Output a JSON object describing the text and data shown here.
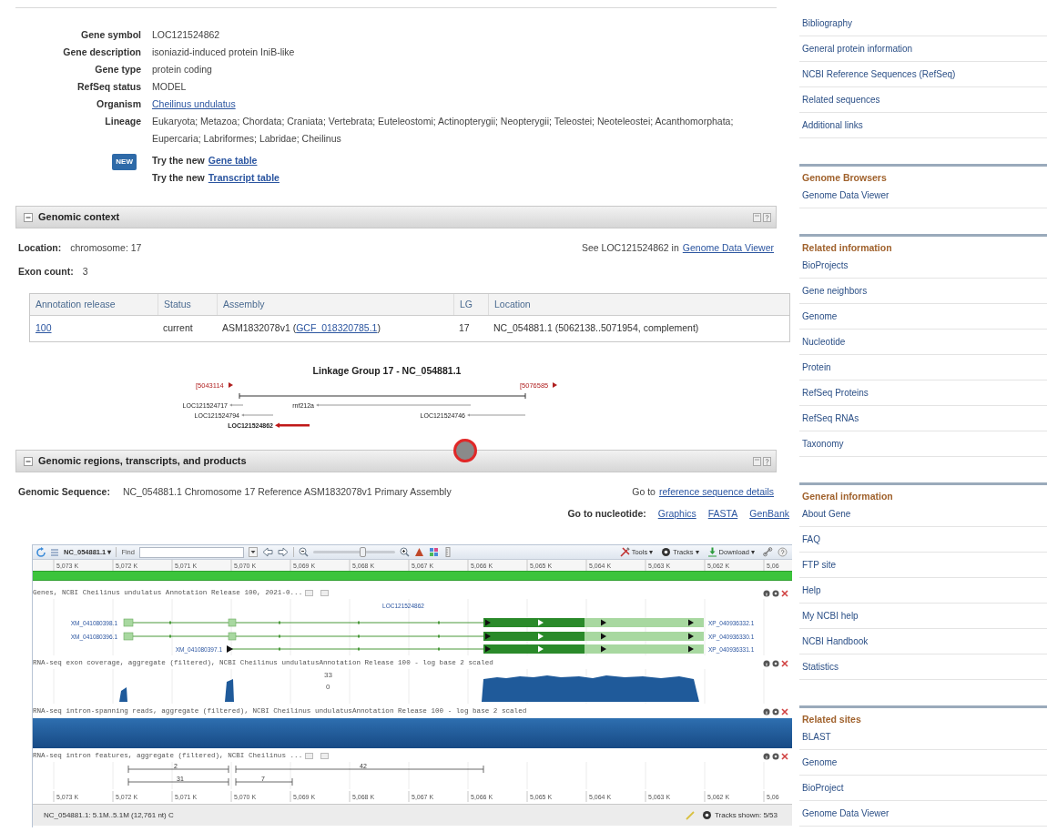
{
  "gene_summary": {
    "rows": [
      {
        "label": "Gene symbol",
        "value": "LOC121524862",
        "link": false
      },
      {
        "label": "Gene description",
        "value": "isoniazid-induced protein IniB-like",
        "link": false
      },
      {
        "label": "Gene type",
        "value": "protein coding",
        "link": false
      },
      {
        "label": "RefSeq status",
        "value": "MODEL",
        "link": false
      },
      {
        "label": "Organism",
        "value": "Cheilinus undulatus",
        "link": true
      },
      {
        "label": "Lineage",
        "value": "Eukaryota; Metazoa; Chordata; Craniata; Vertebrata; Euteleostomi; Actinopterygii; Neopterygii; Teleostei; Neoteleostei; Acanthomorphata; Eupercaria; Labriformes; Labridae; Cheilinus",
        "link": false
      }
    ],
    "badge": "NEW",
    "try_links": [
      {
        "prefix": "Try the new",
        "link": "Gene table"
      },
      {
        "prefix": "Try the new",
        "link": "Transcript table"
      }
    ]
  },
  "genomic_context": {
    "title": "Genomic context",
    "expanded": true,
    "location_label": "Location:",
    "location_value": "chromosome: 17",
    "see_text": "See LOC121524862 in",
    "see_link": "Genome Data Viewer",
    "exon_label": "Exon count:",
    "exon_value": "3",
    "table": {
      "columns": [
        "Annotation release",
        "Status",
        "Assembly",
        "LG",
        "Location"
      ],
      "rows": [
        [
          {
            "text": "100",
            "link": true
          },
          {
            "text": "current"
          },
          {
            "text": "ASM1832078v1 (",
            "link_text": "GCF_018320785.1",
            "after": ")"
          },
          {
            "text": "17"
          },
          {
            "text": "NC_054881.1 (5062138..5071954, complement)"
          }
        ]
      ]
    },
    "map": {
      "title": "Linkage Group 17 - NC_054881.1",
      "left_coord": "[5043114",
      "right_coord": "[5076585",
      "genes": [
        {
          "label": "LOC121524717",
          "current": false
        },
        {
          "label": "rnf212a",
          "current": false
        },
        {
          "label": "LOC121524794",
          "current": false
        },
        {
          "label": "LOC121524746",
          "current": false
        },
        {
          "label": "LOC121524862",
          "current": true
        }
      ]
    }
  },
  "genomic_regions": {
    "title": "Genomic regions, transcripts, and products",
    "expanded": true,
    "sequence_label": "Genomic Sequence:",
    "sequence_value": "NC_054881.1 Chromosome 17 Reference ASM1832078v1 Primary Assembly",
    "goto_text": "Go to",
    "goto_link": "reference sequence details",
    "nucleotide_label": "Go to nucleotide:",
    "nucleotide_links": [
      "Graphics",
      "FASTA",
      "GenBank"
    ],
    "viewer": {
      "sequence_menu": "NC_054881.1 ▾",
      "find_label": "Find",
      "zoom_slider": {
        "level": 0.62
      },
      "menus": [
        "Tools ▾",
        "Tracks ▾",
        "Download ▾"
      ],
      "top_ruler": [
        "5,073 K",
        "5,072 K",
        "5,071 K",
        "5,070 K",
        "5,069 K",
        "5,068 K",
        "5,067 K",
        "5,066 K",
        "5,065 K",
        "5,064 K",
        "5,063 K",
        "5,062 K",
        "5,06"
      ],
      "tracks": [
        {
          "kind": "genes",
          "title": "Genes, NCBI Cheilinus undulatus Annotation Release 100, 2021-0...",
          "gene_label": "LOC121524862",
          "transcripts": [
            {
              "left_label": "XM_041080398.1",
              "right_label": "XP_040936332.1"
            },
            {
              "left_label": "XM_041080396.1",
              "right_label": "XP_040936330.1"
            },
            {
              "left_label": "XM_041080397.1",
              "right_label": "XP_040936331.1"
            }
          ]
        },
        {
          "kind": "coverage",
          "title": "RNA-seq exon coverage, aggregate (filtered), NCBI Cheilinus undulatusAnnotation Release 100 - log base 2 scaled",
          "max_label": "33",
          "min_label": "0"
        },
        {
          "kind": "reads",
          "title": "RNA-seq intron-spanning reads, aggregate (filtered), NCBI Cheilinus undulatusAnnotation Release 100 - log base 2 scaled"
        },
        {
          "kind": "features",
          "title": "RNA-seq intron features, aggregate (filtered), NCBI Cheilinus ...",
          "features": [
            "2",
            "42",
            "31",
            "7"
          ]
        }
      ],
      "bottom_ruler": [
        "5,073 K",
        "5,072 K",
        "5,071 K",
        "5,070 K",
        "5,069 K",
        "5,068 K",
        "5,067 K",
        "5,066 K",
        "5,065 K",
        "5,064 K",
        "5,063 K",
        "5,062 K",
        "5,06"
      ],
      "status": "NC_054881.1: 5.1M..5.1M (12,761 nt) C",
      "tracks_shown": "Tracks shown: 5/53"
    }
  },
  "sidebar": {
    "groups": [
      {
        "items": [
          "Bibliography",
          "General protein information",
          "NCBI Reference Sequences (RefSeq)",
          "Related sequences",
          "Additional links"
        ]
      },
      {
        "title": "Genome Browsers",
        "items": [
          "Genome Data Viewer"
        ]
      },
      {
        "title": "Related information",
        "items": [
          "BioProjects",
          "Gene neighbors",
          "Genome",
          "Nucleotide",
          "Protein",
          "RefSeq Proteins",
          "RefSeq RNAs",
          "Taxonomy"
        ]
      },
      {
        "title": "General information",
        "items": [
          "About Gene",
          "FAQ",
          "FTP site",
          "Help",
          "My NCBI help",
          "NCBI Handbook",
          "Statistics"
        ]
      },
      {
        "title": "Related sites",
        "items": [
          "BLAST",
          "Genome",
          "BioProject",
          "Genome Data Viewer"
        ]
      }
    ]
  }
}
